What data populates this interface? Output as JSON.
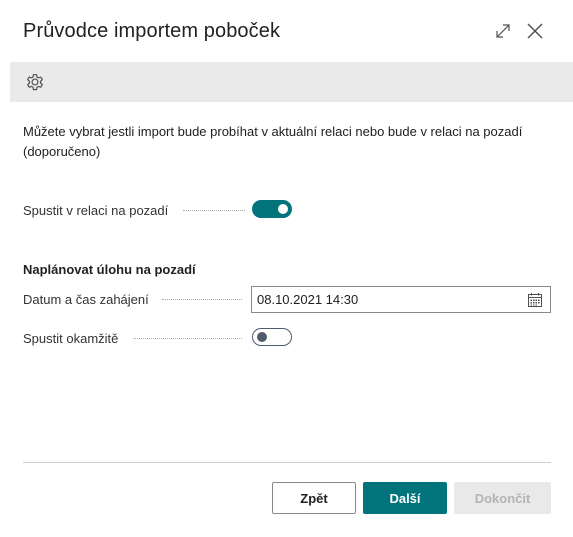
{
  "dialog": {
    "title": "Průvodce importem poboček",
    "expand_icon": "expand-icon",
    "close_icon": "close-icon"
  },
  "toolbar": {
    "settings_icon": "gear-icon"
  },
  "description": "Můžete vybrat jestli import bude probíhat v aktuální relaci nebo bude v relaci na pozadí (doporučeno)",
  "background_run": {
    "label": "Spustit v relaci na pozadí",
    "value": true
  },
  "schedule": {
    "title": "Naplánovat úlohu na pozadí",
    "start_datetime": {
      "label": "Datum a čas zahájení",
      "value": "08.10.2021 14:30",
      "icon": "calendar-icon"
    },
    "run_now": {
      "label": "Spustit okamžitě",
      "value": false
    }
  },
  "footer": {
    "back_label": "Zpět",
    "next_label": "Další",
    "finish_label": "Dokončit"
  },
  "colors": {
    "accent": "#00747a",
    "toolbar_bg": "#eaeaea",
    "disabled_bg": "#e9e9e9",
    "disabled_text": "#b4b4b4"
  }
}
